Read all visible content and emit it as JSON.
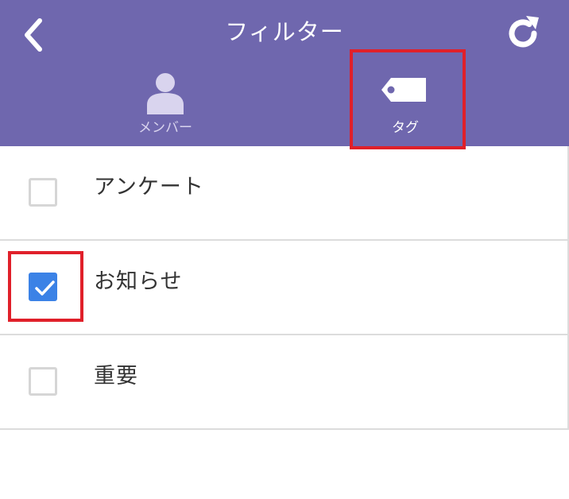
{
  "header": {
    "title": "フィルター",
    "back_icon": "chevron-left-icon",
    "refresh_icon": "refresh-icon",
    "background": "#6f67ae"
  },
  "tabs": [
    {
      "label": "メンバー",
      "icon": "person-icon",
      "selected": false
    },
    {
      "label": "タグ",
      "icon": "tag-icon",
      "selected": true
    }
  ],
  "tag_list": [
    {
      "label": "アンケート",
      "checked": false
    },
    {
      "label": "お知らせ",
      "checked": true
    },
    {
      "label": "重要",
      "checked": false
    }
  ],
  "colors": {
    "accent": "#3b82e6",
    "highlight": "#e0202a"
  }
}
